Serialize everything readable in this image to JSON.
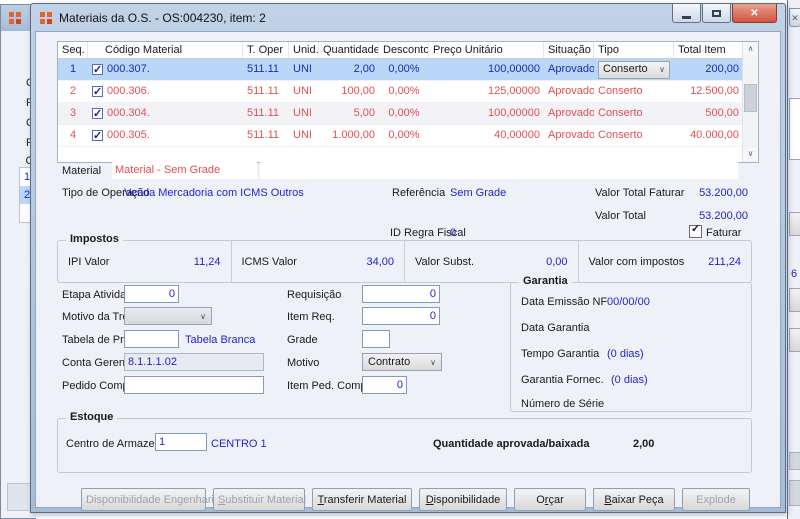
{
  "window": {
    "title": "Materiais da O.S. - OS:004230, item: 2"
  },
  "bg_left": {
    "labels": [
      "C",
      "R",
      "C",
      "R",
      "O"
    ],
    "list": [
      "1",
      "2"
    ]
  },
  "bg_right": {
    "value": "6",
    "close_glyph": "✕"
  },
  "grid": {
    "columns": [
      "Seq.",
      "Código Material",
      "T. Oper",
      "Unid.",
      "Quantidade",
      "Desconto",
      "Preço Unitário",
      "Situação",
      "Tipo",
      "Total Item"
    ],
    "rows": [
      {
        "seq": "1",
        "checked": true,
        "codigo": "000.307.",
        "toper": "511.11",
        "unid": "UNI",
        "quantidade": "2,00",
        "desconto": "0,00%",
        "preco": "100,00000",
        "situacao": "Aprovado",
        "tipo": "Conserto",
        "total": "200,00",
        "selected": true
      },
      {
        "seq": "2",
        "checked": true,
        "codigo": "000.306.",
        "toper": "511.11",
        "unid": "UNI",
        "quantidade": "100,00",
        "desconto": "0,00%",
        "preco": "125,00000",
        "situacao": "Aprovado",
        "tipo": "Conserto",
        "total": "12.500,00",
        "selected": false
      },
      {
        "seq": "3",
        "checked": true,
        "codigo": "000.304.",
        "toper": "511.11",
        "unid": "UNI",
        "quantidade": "5,00",
        "desconto": "0,00%",
        "preco": "100,00000",
        "situacao": "Aprovado",
        "tipo": "Conserto",
        "total": "500,00",
        "selected": false
      },
      {
        "seq": "4",
        "checked": true,
        "codigo": "000.305.",
        "toper": "511.11",
        "unid": "UNI",
        "quantidade": "1.000,00",
        "desconto": "0,00%",
        "preco": "40,00000",
        "situacao": "Aprovado",
        "tipo": "Conserto",
        "total": "40.000,00",
        "selected": false
      }
    ]
  },
  "material_row": {
    "label": "Material",
    "value": "Material - Sem Grade"
  },
  "detail": {
    "tipo_operacao_label": "Tipo de Operação",
    "tipo_operacao_value": "Venda Mercadoria com ICMS Outros",
    "referencia_label": "Referência",
    "referencia_value": "Sem Grade",
    "valor_total_faturar_label": "Valor Total Faturar",
    "valor_total_faturar_value": "53.200,00",
    "valor_total_label": "Valor Total",
    "valor_total_value": "53.200,00",
    "id_regra_fiscal_label": "ID Regra Fiscal",
    "id_regra_fiscal_value": "0",
    "faturar_label": "Faturar"
  },
  "impostos": {
    "title": "Impostos",
    "items": [
      {
        "label": "IPI Valor",
        "value": "11,24"
      },
      {
        "label": "ICMS Valor",
        "value": "34,00"
      },
      {
        "label": "Valor Subst.",
        "value": "0,00"
      },
      {
        "label": "Valor com impostos",
        "value": "211,24"
      }
    ]
  },
  "form": {
    "etapa_atividade": {
      "label": "Etapa Atividade",
      "value": "0"
    },
    "motivo_troca": {
      "label": "Motivo da Troca",
      "value": ""
    },
    "tabela_preco": {
      "label": "Tabela de Preço",
      "value": "",
      "hint": "Tabela Branca"
    },
    "conta_gerencial": {
      "label": "Conta Gerencial",
      "value": "8.1.1.1.02"
    },
    "pedido_compra": {
      "label": "Pedido Compra",
      "value": ""
    },
    "requisicao": {
      "label": "Requisição",
      "value": "0"
    },
    "item_req": {
      "label": "Item Req.",
      "value": "0"
    },
    "grade": {
      "label": "Grade",
      "value": ""
    },
    "motivo": {
      "label": "Motivo",
      "value": "Contrato"
    },
    "item_ped_compra": {
      "label": "Item Ped. Compra",
      "value": "0"
    }
  },
  "garantia": {
    "title": "Garantia",
    "rows": [
      {
        "label": "Data Emissão NF",
        "value": "00/00/00"
      },
      {
        "label": "Data Garantia",
        "value": ""
      },
      {
        "label": "Tempo Garantia",
        "value": "(0 dias)"
      },
      {
        "label": "Garantia Fornec.",
        "value": "(0 dias)"
      },
      {
        "label": "Número de Série",
        "value": ""
      }
    ]
  },
  "estoque": {
    "title": "Estoque",
    "centro_label": "Centro de Armazenagem",
    "centro_value": "1",
    "centro_desc": "CENTRO 1",
    "qtd_label": "Quantidade aprovada/baixada",
    "qtd_value": "2,00"
  },
  "footer": {
    "buttons": [
      {
        "name": "disponibilidade-engenharia-button",
        "pre": "Disponibilidade Engenharia",
        "mn": "",
        "rest": "",
        "enabled": false
      },
      {
        "name": "substituir-material-button",
        "pre": "",
        "mn": "S",
        "rest": "ubstituir Material",
        "enabled": false
      },
      {
        "name": "transferir-material-button",
        "pre": "",
        "mn": "T",
        "rest": "ransferir Material",
        "enabled": true
      },
      {
        "name": "disponibilidade-button",
        "pre": "",
        "mn": "D",
        "rest": "isponibilidade",
        "enabled": true
      },
      {
        "name": "orcar-button",
        "pre": "O",
        "mn": "r",
        "rest": "çar",
        "enabled": true
      },
      {
        "name": "baixar-peca-button",
        "pre": "",
        "mn": "B",
        "rest": "aixar Peça",
        "enabled": true
      },
      {
        "name": "explode-button",
        "pre": "Explode",
        "mn": "",
        "rest": "",
        "enabled": false
      }
    ]
  },
  "colors": {
    "titlebar": "#aec2da",
    "selection": "#b9d8f9",
    "value_blue": "#2323cc",
    "row_red": "#e05050",
    "client_bg": "#eef1f8",
    "close_red": "#ce5440",
    "app_orange": "#e8622a"
  }
}
